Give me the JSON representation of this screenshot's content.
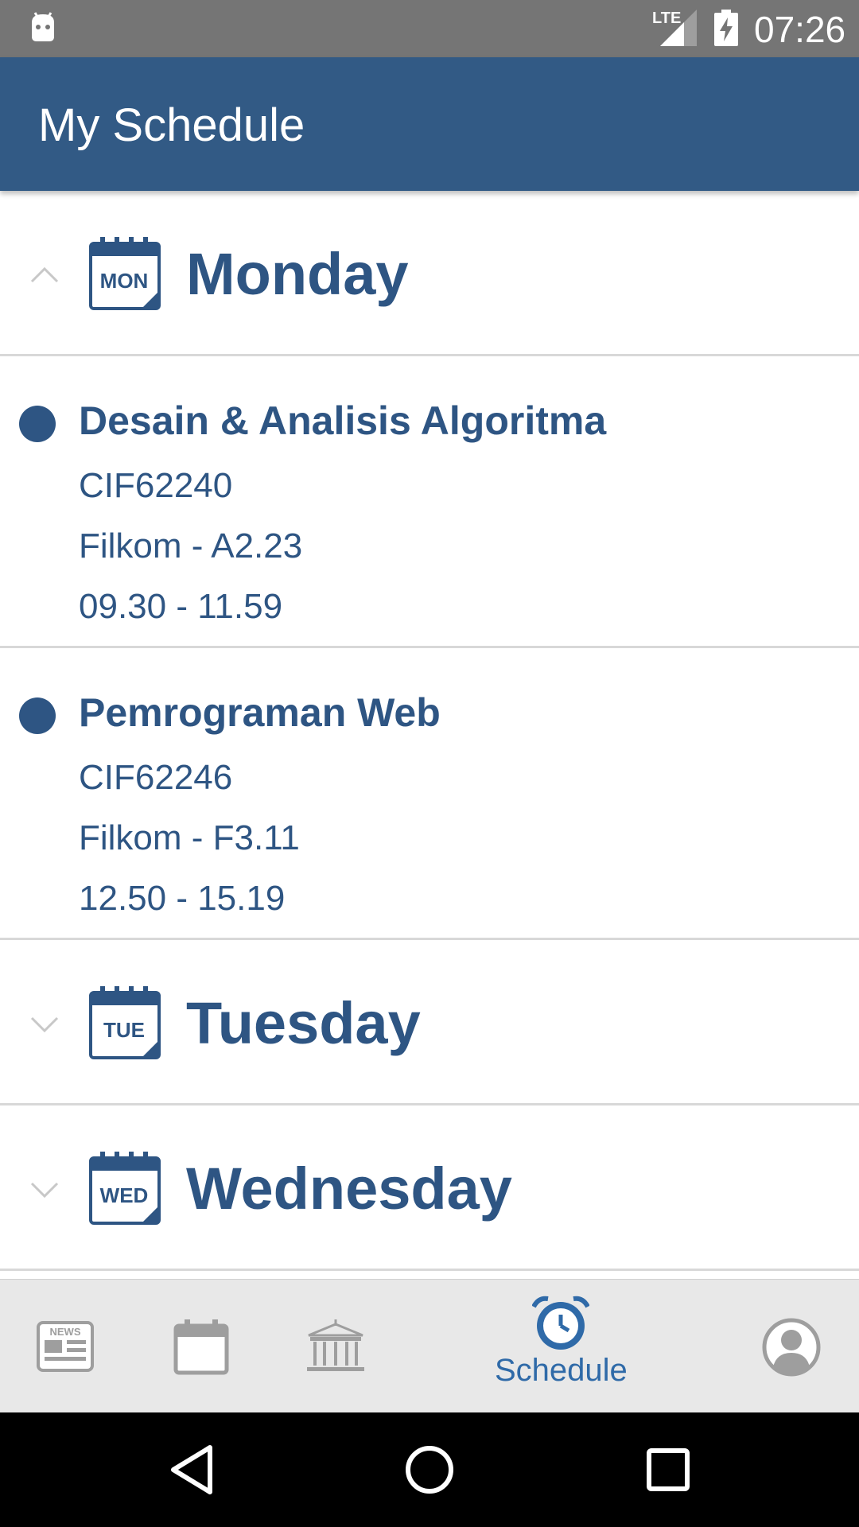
{
  "status_bar": {
    "network": "LTE",
    "time": "07:26"
  },
  "app_bar": {
    "title": "My Schedule"
  },
  "days": [
    {
      "name": "Monday",
      "abbr": "MON",
      "expanded": true,
      "courses": [
        {
          "name": "Desain & Analisis Algoritma",
          "code": "CIF62240",
          "room": "Filkom - A2.23",
          "time": "09.30 - 11.59"
        },
        {
          "name": "Pemrograman Web",
          "code": "CIF62246",
          "room": "Filkom - F3.11",
          "time": "12.50 - 15.19"
        }
      ]
    },
    {
      "name": "Tuesday",
      "abbr": "TUE",
      "expanded": false
    },
    {
      "name": "Wednesday",
      "abbr": "WED",
      "expanded": false
    }
  ],
  "bottom_nav": {
    "items": [
      {
        "icon": "news-icon",
        "label": "NEWS"
      },
      {
        "icon": "calendar-icon"
      },
      {
        "icon": "building-icon"
      },
      {
        "icon": "alarm-clock-icon",
        "label": "Schedule",
        "active": true
      },
      {
        "icon": "profile-icon"
      }
    ]
  },
  "colors": {
    "primary": "#325a85",
    "text_primary": "#2e5583",
    "active_nav": "#2f6aa8",
    "status_bar": "#757575",
    "nav_background": "#e8e8e8"
  }
}
